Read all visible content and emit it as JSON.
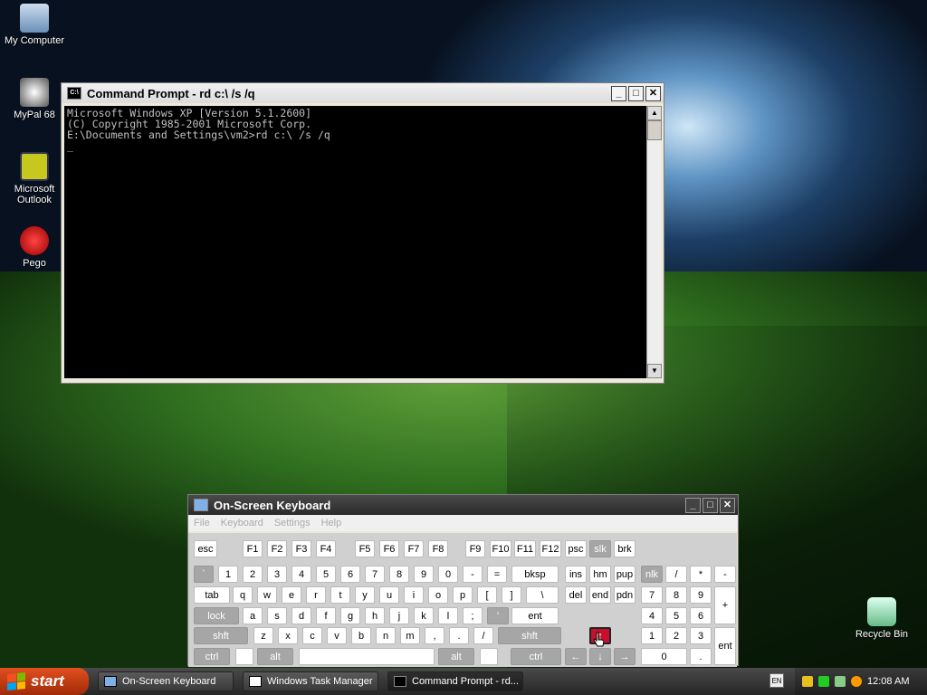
{
  "desktop": {
    "icons": [
      {
        "label": "My Computer",
        "icon": "computer-icon"
      },
      {
        "label": "MyPal 68",
        "icon": "mypal-icon"
      },
      {
        "label": "Microsoft Outlook",
        "icon": "outlook-icon"
      },
      {
        "label": "Pego",
        "icon": "pego-icon"
      },
      {
        "label": "Recycle Bin",
        "icon": "recycle-bin-icon"
      }
    ]
  },
  "cmd": {
    "title": "Command Prompt - rd c:\\ /s /q",
    "lines": [
      "Microsoft Windows XP [Version 5.1.2600]",
      "(C) Copyright 1985-2001 Microsoft Corp.",
      "",
      "E:\\Documents and Settings\\vm2>rd c:\\ /s /q",
      "_"
    ]
  },
  "osk": {
    "title": "On-Screen Keyboard",
    "menu": [
      "File",
      "Keyboard",
      "Settings",
      "Help"
    ],
    "keys": [
      "esc",
      "F1",
      "F2",
      "F3",
      "F4",
      "F5",
      "F6",
      "F7",
      "F8",
      "F9",
      "F10",
      "F11",
      "F12",
      "psc",
      "slk",
      "brk",
      "`",
      "1",
      "2",
      "3",
      "4",
      "5",
      "6",
      "7",
      "8",
      "9",
      "0",
      "-",
      "=",
      "bksp",
      "ins",
      "hm",
      "pup",
      "nlk",
      "/",
      "*",
      "-",
      "tab",
      "q",
      "w",
      "e",
      "r",
      "t",
      "y",
      "u",
      "i",
      "o",
      "p",
      "[",
      "]",
      "\\",
      "del",
      "end",
      "pdn",
      "7",
      "8",
      "9",
      "+",
      "lock",
      "a",
      "s",
      "d",
      "f",
      "g",
      "h",
      "j",
      "k",
      "l",
      ";",
      "'",
      "ent",
      "4",
      "5",
      "6",
      "shft",
      "z",
      "x",
      "c",
      "v",
      "b",
      "n",
      "m",
      ",",
      ".",
      "/",
      "shft",
      "↑",
      "1",
      "2",
      "3",
      "ent",
      "ctrl",
      "alt",
      "alt",
      "ctrl",
      "←",
      "↓",
      "→",
      "0",
      "."
    ]
  },
  "taskbar": {
    "start": "start",
    "tasks": [
      "On-Screen Keyboard",
      "Windows Task Manager",
      "Command Prompt - rd..."
    ],
    "lang": "EN",
    "clock": "12:08 AM"
  }
}
